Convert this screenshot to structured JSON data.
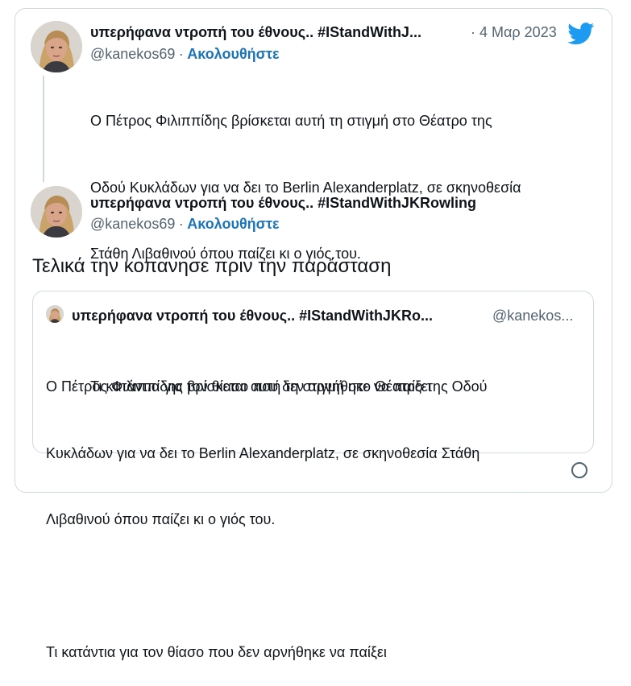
{
  "tweet1": {
    "display_name": "υπερήφανα ντροπή του έθνους.. #IStandWithJ...",
    "separator": "·",
    "date": "4 Μαρ 2023",
    "handle": "@kanekos69",
    "follow_label": "Ακολουθήστε",
    "lines": [
      "Ο Πέτρος Φιλιππίδης βρίσκεται αυτή τη στιγμή στο Θέατρο της",
      "Οδού Κυκλάδων για να δει το Berlin Alexanderplatz, σε σκηνοθεσία",
      "Στάθη Λιβαθινού όπου παίζει κι ο γιός του.",
      "",
      "Τι κατάντια για τον θίασο που δεν αρνήθηκε να παίξει"
    ]
  },
  "tweet2": {
    "display_name": "υπερήφανα ντροπή του έθνους.. #IStandWithJKRowling",
    "handle": "@kanekos69",
    "separator": "·",
    "follow_label": "Ακολουθήστε",
    "text": "Τελικά την κοπανησε πριν την παράσταση"
  },
  "quote": {
    "display_name": "υπερήφανα ντροπή του έθνους.. #IStandWithJKRo...",
    "handle": "@kanekos...",
    "lines": [
      "Ο Πέτρος Φιλιππίδης βρίσκεται αυτή τη στιγμή στο Θέατρο της Οδού",
      "Κυκλάδων για να δει το Berlin Alexanderplatz, σε σκηνοθεσία Στάθη",
      "Λιβαθινού όπου παίζει κι ο γιός του.",
      "",
      "Τι κατάντια για τον θίασο που δεν αρνήθηκε να παίξει"
    ]
  },
  "icons": {
    "brand": "twitter-bird-icon",
    "info": "info-icon"
  },
  "colors": {
    "twitter_blue": "#1d9bf0",
    "follow_blue": "#1d75b8",
    "secondary_text": "#536471",
    "border": "#cfd9de"
  }
}
